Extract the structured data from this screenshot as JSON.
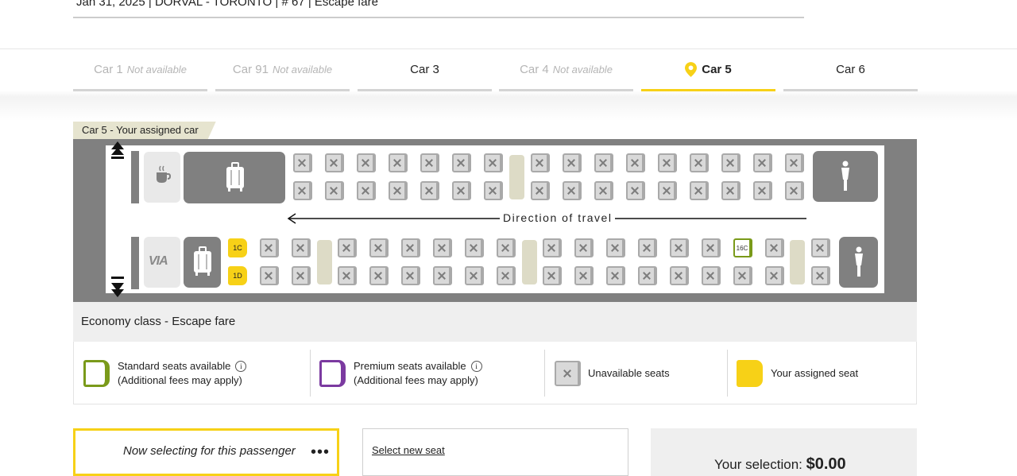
{
  "trip": {
    "info": "Jan 31, 2025 | DORVAL - TORONTO | # 67 |  Escape fare"
  },
  "tabs": [
    {
      "car": "Car 1",
      "status": "Not available",
      "state": "disabled"
    },
    {
      "car": "Car 91",
      "status": "Not available",
      "state": "disabled"
    },
    {
      "car": "Car 3",
      "status": "",
      "state": "enabled"
    },
    {
      "car": "Car 4",
      "status": "Not available",
      "state": "disabled"
    },
    {
      "car": "Car 5",
      "status": "",
      "state": "active"
    },
    {
      "car": "Car 6",
      "status": "",
      "state": "enabled"
    }
  ],
  "car_map": {
    "label": "Car 5 - Your assigned car",
    "direction": "Direction of travel",
    "logo": "VIA",
    "assigned_seats": [
      "1C",
      "1D"
    ],
    "available_seats": [
      "16C"
    ],
    "icons": [
      "coffee-icon",
      "luggage-icon",
      "restroom-icon",
      "arrow-up-icon",
      "arrow-down-icon"
    ]
  },
  "class_label": "Economy class - Escape fare",
  "legend": {
    "standard_line1": "Standard seats available",
    "standard_line2": "(Additional fees may apply)",
    "premium_line1": "Premium seats available",
    "premium_line2": "(Additional fees may apply)",
    "unavailable": "Unavailable seats",
    "assigned": "Your assigned seat"
  },
  "colors": {
    "accent_yellow": "#f7d117",
    "standard_green": "#7a9a1a",
    "premium_purple": "#7b3aa0",
    "car_gray": "#808080"
  },
  "passenger": {
    "selecting_text": "Now selecting for this passenger",
    "menu": "•••"
  },
  "select": {
    "link": "Select new seat"
  },
  "summary": {
    "label": "Your selection:",
    "amount": "$0.00"
  }
}
